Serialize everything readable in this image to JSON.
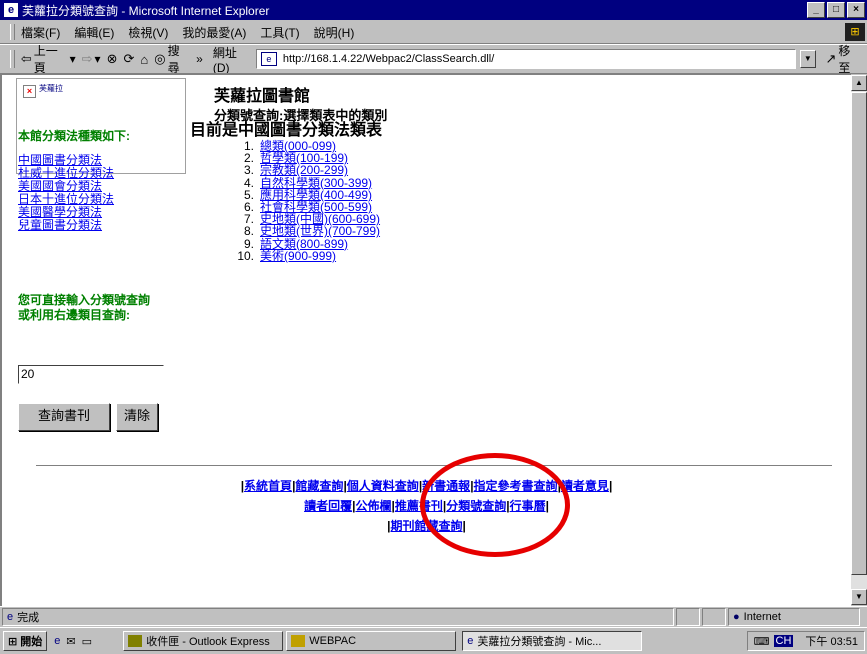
{
  "window": {
    "title": "芙蘿拉分類號查詢 - Microsoft Internet Explorer"
  },
  "menu": [
    "檔案(F)",
    "編輯(E)",
    "檢視(V)",
    "我的最愛(A)",
    "工具(T)",
    "說明(H)"
  ],
  "toolbar": {
    "back": "上一頁",
    "search": "搜尋",
    "more": "»",
    "address_label": "網址(D)",
    "address": "http://168.1.4.22/Webpac2/ClassSearch.dll/",
    "go": "移至"
  },
  "page": {
    "logo_alt": "芙蘿拉",
    "library_name": "芙蘿拉圖書館",
    "subtitle": "分類號查詢:選擇類表中的類別",
    "left_heading": "本館分類法種類如下:",
    "schemes": [
      "中國圖書分類法",
      "杜威十進位分類法",
      "美國國會分類法",
      "日本十進位分類法",
      "美國醫學分類法",
      "兒童圖書分類法"
    ],
    "hint": "您可直接輸入分類號查詢或利用右邊類目查詢:",
    "code_input": "20",
    "search_button": "查詢書刊",
    "clear_button": "清除",
    "current_title": "目前是中國圖書分類法類表",
    "categories": [
      {
        "num": "1.",
        "label": "總類(000-099)"
      },
      {
        "num": "2.",
        "label": "哲學類(100-199)"
      },
      {
        "num": "3.",
        "label": "宗教類(200-299)"
      },
      {
        "num": "4.",
        "label": "自然科學類(300-399)"
      },
      {
        "num": "5.",
        "label": "應用科學類(400-499)"
      },
      {
        "num": "6.",
        "label": "社會科學類(500-599)"
      },
      {
        "num": "7.",
        "label": "史地類(中國)(600-699)"
      },
      {
        "num": "8.",
        "label": "史地類(世界)(700-799)"
      },
      {
        "num": "9.",
        "label": "語文類(800-899)"
      },
      {
        "num": "10.",
        "label": "美術(900-999)"
      }
    ],
    "footer_row1": [
      "系統首頁",
      "館藏查詢",
      "個人資料查詢",
      "新書通報",
      "指定參考書查詢",
      "讀者意見"
    ],
    "footer_row2": [
      "讀者回覆",
      "公佈欄",
      "推薦書刊",
      "分類號查詢",
      "行事曆"
    ],
    "footer_row3": [
      "期刊館藏查詢"
    ]
  },
  "status": {
    "text": "完成",
    "zone": "Internet"
  },
  "taskbar": {
    "start": "開始",
    "tasks": [
      "收件匣 - Outlook Express",
      "WEBPAC",
      "芙蘿拉分類號查詢 - Mic..."
    ],
    "ime": "CH",
    "clock": "下午 03:51"
  },
  "colors": {
    "link": "#0000ee",
    "green_heading": "#008000",
    "annotation_circle": "#e60000",
    "titlebar": "#000080"
  }
}
